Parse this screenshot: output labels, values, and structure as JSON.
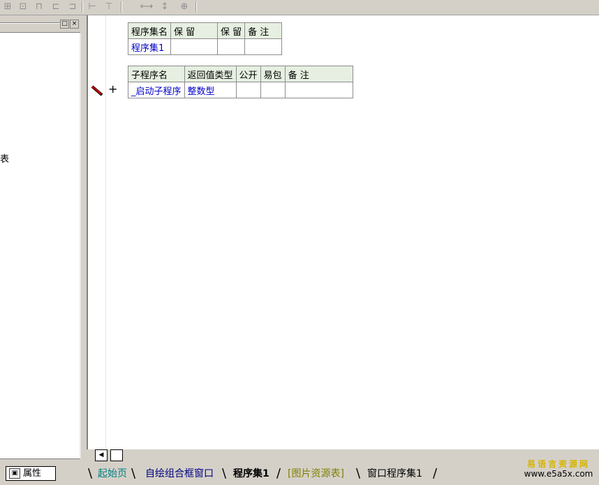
{
  "toolbar": {
    "buttons": [
      "align-left-icon",
      "align-center-icon",
      "align-top-icon",
      "align-right-icon",
      "same-width-icon",
      "same-height-icon",
      "hspace-icon",
      "vspace-icon",
      "center-icon"
    ]
  },
  "left_panel": {
    "truncated_text": "表",
    "property_tab_label": "属性"
  },
  "assembly_table": {
    "headers": [
      "程序集名",
      "保 留",
      "保 留",
      "备 注"
    ],
    "row": [
      "程序集1",
      "",
      "",
      ""
    ]
  },
  "subroutine_table": {
    "headers": [
      "子程序名",
      "返回值类型",
      "公开",
      "易包",
      "备 注"
    ],
    "row": [
      "_启动子程序",
      "整数型",
      "",
      "",
      ""
    ]
  },
  "editor": {
    "expand_symbol": "+"
  },
  "tabs": [
    {
      "label": "起始页",
      "color": "#008080"
    },
    {
      "label": "自绘组合框窗口",
      "color": "#000080"
    },
    {
      "label": "程序集1",
      "color": "#000000"
    },
    {
      "label": "[图片资源表]",
      "color": "#808000"
    },
    {
      "label": "窗口程序集1",
      "color": "#000000"
    }
  ],
  "watermark": {
    "name": "易语言资源网",
    "url": "www.e5a5x.com"
  }
}
